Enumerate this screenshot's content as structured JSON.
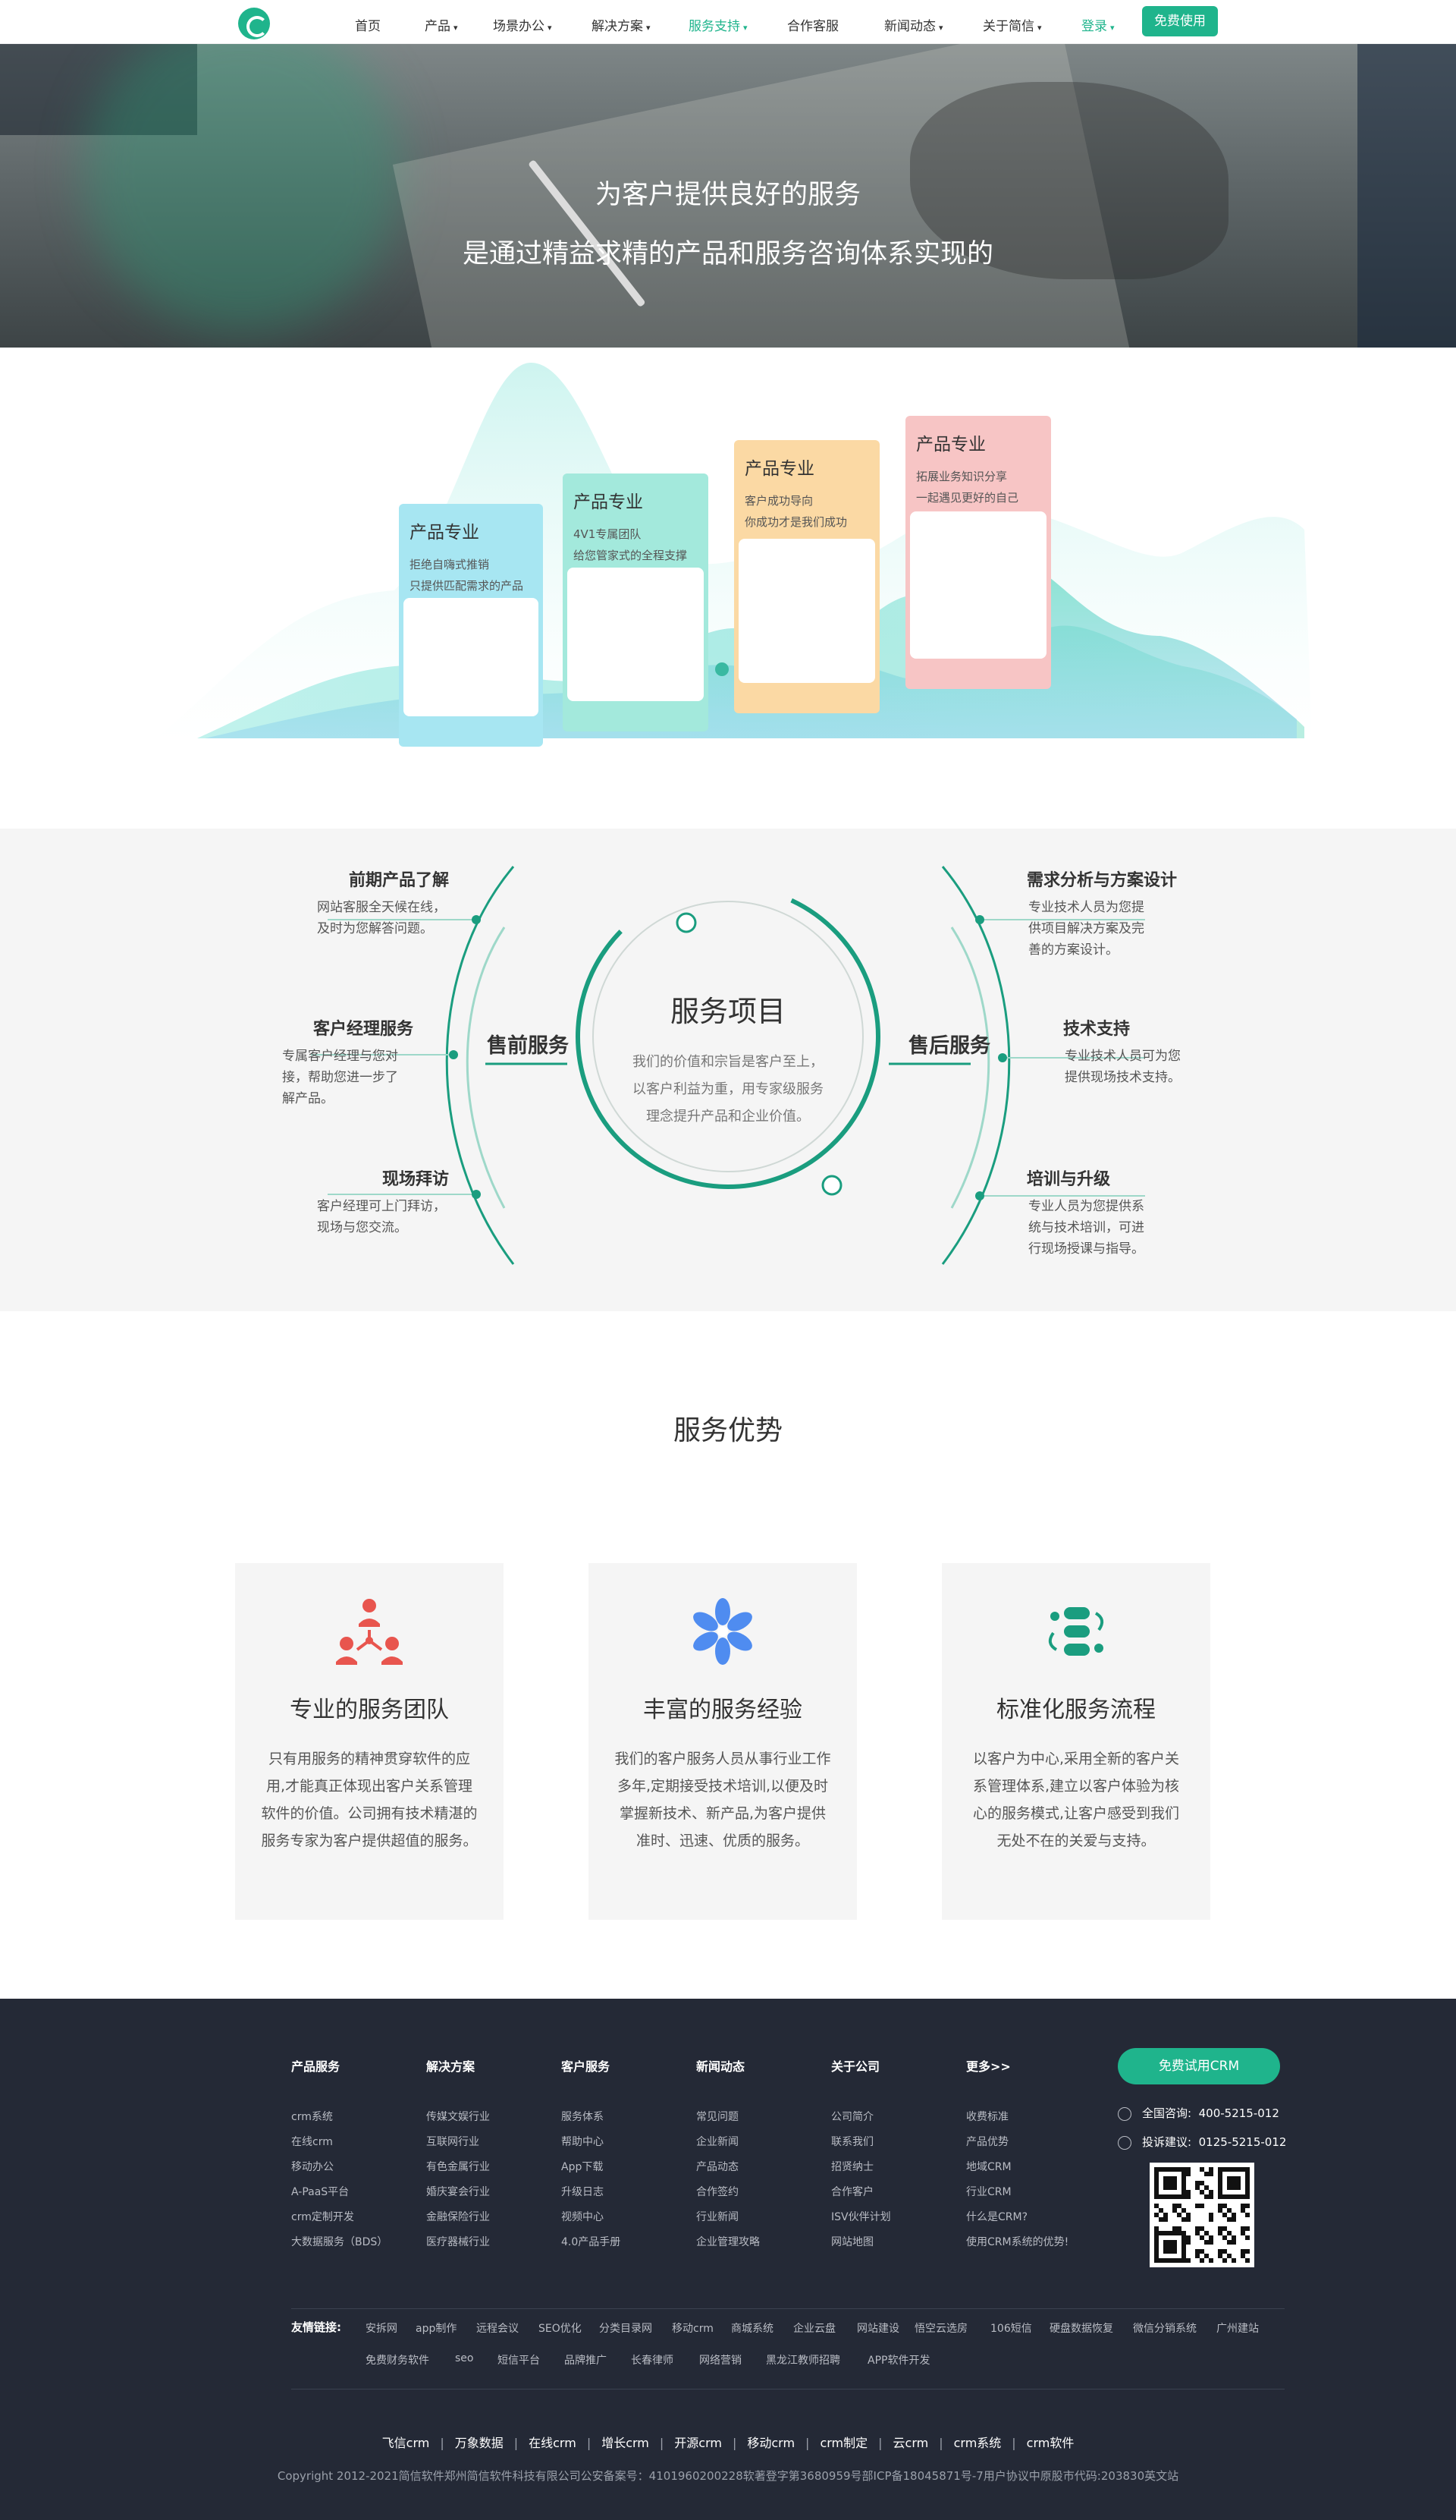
{
  "nav": {
    "items": [
      {
        "label": "首页",
        "caret": ""
      },
      {
        "label": "产品",
        "caret": "▾"
      },
      {
        "label": "场景办公",
        "caret": "▾"
      },
      {
        "label": "解决方案",
        "caret": "▾"
      },
      {
        "label": "服务支持",
        "caret": "▾"
      },
      {
        "label": "合作客服",
        "caret": ""
      },
      {
        "label": "新闻动态",
        "caret": "▾"
      },
      {
        "label": "关于简信",
        "caret": "▾"
      }
    ],
    "active_index": 4,
    "login": "登录",
    "login_caret": "▾",
    "cta": "免费使用",
    "accent": "#1fb48c"
  },
  "hero": {
    "line1": "为客户提供良好的服务",
    "line2": "是通过精益求精的产品和服务咨询体系实现的"
  },
  "product_cards": [
    {
      "title": "产品专业",
      "lines": [
        "拒绝自嗨式推销",
        "只提供匹配需求的产品"
      ],
      "color": "#a7e6f2"
    },
    {
      "title": "产品专业",
      "lines": [
        "4V1专属团队",
        "给您管家式的全程支撑"
      ],
      "color": "#a3e9dc"
    },
    {
      "title": "产品专业",
      "lines": [
        "客户成功导向",
        "你成功才是我们成功"
      ],
      "color": "#fbd9a4"
    },
    {
      "title": "产品专业",
      "lines": [
        "拓展业务知识分享",
        "一起遇见更好的自己"
      ],
      "color": "#f7c5c5"
    }
  ],
  "services": {
    "center_title": "服务项目",
    "center_text": [
      "我们的价值和宗旨是客户至上，",
      "以客户利益为重，用专家级服务",
      "理念提升产品和企业价值。"
    ],
    "pre_label": "售前服务",
    "post_label": "售后服务",
    "pre": [
      {
        "title": "前期产品了解",
        "lines": [
          "网站客服全天候在线，",
          "及时为您解答问题。"
        ]
      },
      {
        "title": "客户经理服务",
        "lines": [
          "专属客户经理与您对",
          "接，帮助您进一步了",
          "解产品。"
        ]
      },
      {
        "title": "现场拜访",
        "lines": [
          "客户经理可上门拜访，",
          "现场与您交流。"
        ]
      }
    ],
    "post": [
      {
        "title": "需求分析与方案设计",
        "lines": [
          "专业技术人员为您提",
          "供项目解决方案及完",
          "善的方案设计。"
        ]
      },
      {
        "title": "技术支持",
        "lines": [
          "专业技术人员可为您",
          "提供现场技术支持。"
        ]
      },
      {
        "title": "培训与升级",
        "lines": [
          "专业人员为您提供系",
          "统与技术培训，可进",
          "行现场授课与指导。"
        ]
      }
    ]
  },
  "advantages": {
    "title": "服务优势",
    "cards": [
      {
        "name": "专业的服务团队",
        "icon": "team-icon",
        "desc": [
          "只有用服务的精神贯穿软件的应",
          "用,才能真正体现出客户关系管理",
          "软件的价值。公司拥有技术精湛的",
          "服务专家为客户提供超值的服务。"
        ]
      },
      {
        "name": "丰富的服务经验",
        "icon": "flower-icon",
        "desc": [
          "我们的客户服务人员从事行业工作",
          "多年,定期接受技术培训,以便及时",
          "掌握新技术、新产品,为客户提供",
          "准时、迅速、优质的服务。"
        ]
      },
      {
        "name": "标准化服务流程",
        "icon": "cycle-icon",
        "desc": [
          "以客户为中心,采用全新的客户关",
          "系管理体系,建立以客户体验为核",
          "心的服务模式,让客户感受到我们",
          "无处不在的关爱与支持。"
        ]
      }
    ]
  },
  "footer": {
    "columns": [
      {
        "title": "产品服务",
        "items": [
          "crm系统",
          "在线crm",
          "移动办公",
          "A-PaaS平台",
          "crm定制开发",
          "大数据服务（BDS）"
        ]
      },
      {
        "title": "解决方案",
        "items": [
          "传媒文娱行业",
          "互联网行业",
          "有色金属行业",
          "婚庆宴会行业",
          "金融保险行业",
          "医疗器械行业"
        ]
      },
      {
        "title": "客户服务",
        "items": [
          "服务体系",
          "帮助中心",
          "App下载",
          "升级日志",
          "视频中心",
          "4.0产品手册"
        ]
      },
      {
        "title": "新闻动态",
        "items": [
          "常见问题",
          "企业新闻",
          "产品动态",
          "合作签约",
          "行业新闻",
          "企业管理攻略"
        ]
      },
      {
        "title": "关于公司",
        "items": [
          "公司简介",
          "联系我们",
          "招贤纳士",
          "合作客户",
          "ISV伙伴计划",
          "网站地图"
        ]
      },
      {
        "title": "更多>>",
        "items": [
          "收费标准",
          "产品优势",
          "地域CRM",
          "行业CRM",
          "什么是CRM?",
          "使用CRM系统的优势!"
        ]
      }
    ],
    "cta": "免费试用CRM",
    "phone_label": "全国咨询:",
    "phone": "400-5215-012",
    "complaint_label": "投诉建议:",
    "complaint": "0125-5215-012",
    "friend_label": "友情链接:",
    "friend_links_row1": [
      "安拆网",
      "app制作",
      "远程会议",
      "SEO优化",
      "分类目录网",
      "移动crm",
      "商城系统",
      "企业云盘",
      "网站建设",
      "悟空云选房",
      "106短信",
      "硬盘数据恢复",
      "微信分销系统",
      "广州建站"
    ],
    "friend_links_row2": [
      "免费财务软件",
      "seo",
      "短信平台",
      "品牌推广",
      "长春律师",
      "网络营销",
      "黑龙江教师招聘",
      "APP软件开发"
    ],
    "bottom_links": [
      "飞信crm",
      "万象数据",
      "在线crm",
      "增长crm",
      "开源crm",
      "移动crm",
      "crm制定",
      "云crm",
      "crm系统",
      "crm软件"
    ],
    "copyright": "Copyright 2012-2021简信软件郑州简信软件科技有限公司公安备案号：41019602002​28软著登字第3680959号部ICP备18045871号-7用户协议中原股市代码:203830英文站"
  }
}
